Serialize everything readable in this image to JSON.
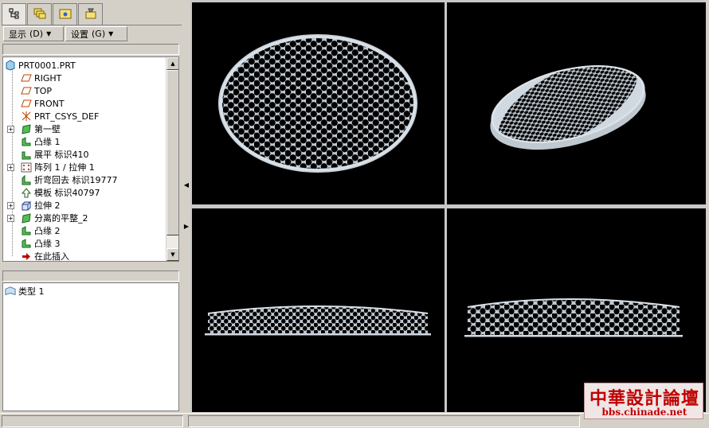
{
  "menu": {
    "display_label": "显示",
    "display_key": "(D)",
    "settings_label": "设置",
    "settings_key": "(G)"
  },
  "tabs": [
    "model-tree-icon",
    "layers-icon",
    "folder-icon",
    "tools-icon"
  ],
  "tree": {
    "items": [
      {
        "label": "PRT0001.PRT",
        "icon": "part-icon"
      },
      {
        "label": "RIGHT",
        "icon": "datum-plane-icon"
      },
      {
        "label": "TOP",
        "icon": "datum-plane-icon"
      },
      {
        "label": "FRONT",
        "icon": "datum-plane-icon"
      },
      {
        "label": "PRT_CSYS_DEF",
        "icon": "csys-icon"
      },
      {
        "label": "第一壁",
        "icon": "wall-icon"
      },
      {
        "label": "凸缘 1",
        "icon": "flange-icon"
      },
      {
        "label": "展平 标识410",
        "icon": "unbend-icon"
      },
      {
        "label": "阵列 1 / 拉伸 1",
        "icon": "pattern-icon"
      },
      {
        "label": "折弯回去 标识19777",
        "icon": "bend-back-icon"
      },
      {
        "label": "模板 标识40797",
        "icon": "form-icon"
      },
      {
        "label": "拉伸 2",
        "icon": "extrude-icon"
      },
      {
        "label": "分离的平整_2",
        "icon": "wall-icon"
      },
      {
        "label": "凸缘 2",
        "icon": "flange-icon"
      },
      {
        "label": "凸缘 3",
        "icon": "flange-icon"
      },
      {
        "label": "在此插入",
        "icon": "insert-here-arrow-icon"
      }
    ]
  },
  "layers": {
    "items": [
      {
        "label": "类型 1",
        "icon": "layer-type-icon"
      }
    ]
  },
  "viewports": [
    "top-view",
    "isometric-view",
    "front-view",
    "side-view"
  ],
  "watermark": {
    "title": "中華設計論壇",
    "url": "bbs.chinade.net"
  },
  "colors": {
    "viewport_bg": "#000000",
    "mesh": "#b8c0c8",
    "watermark": "#c00000"
  }
}
